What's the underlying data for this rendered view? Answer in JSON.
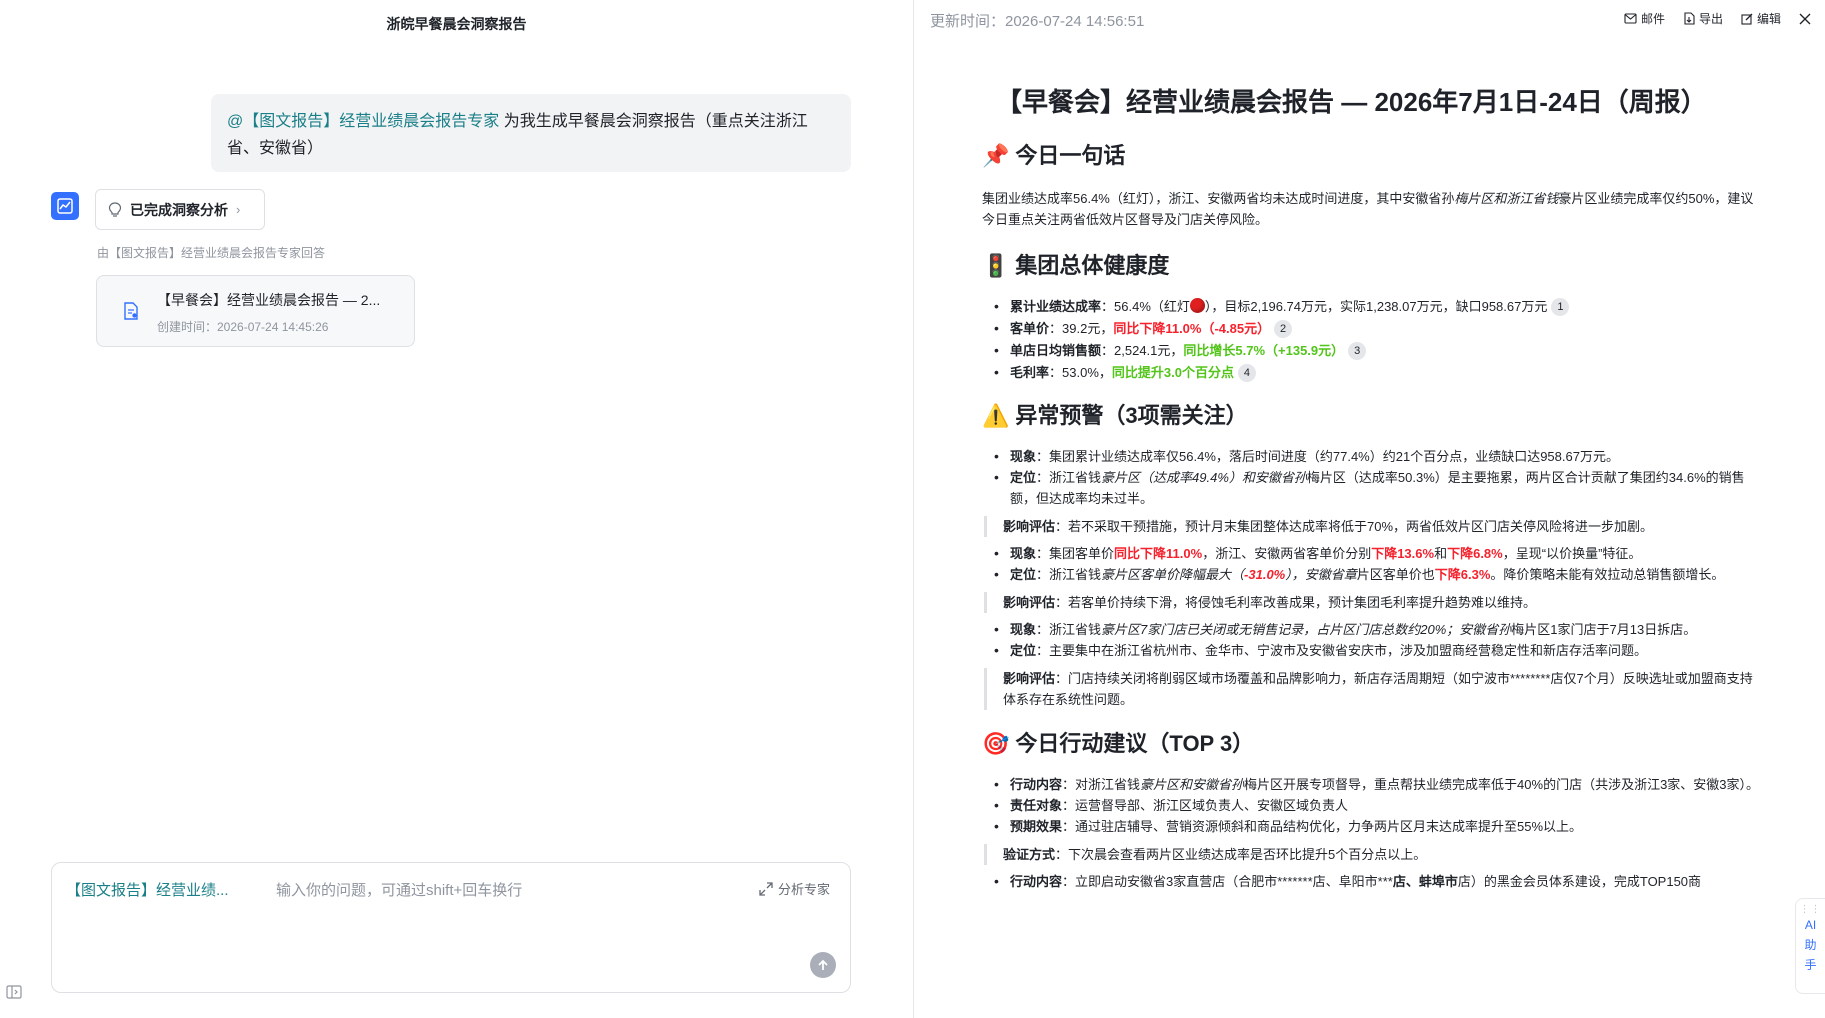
{
  "left": {
    "title": "浙皖早餐晨会洞察报告",
    "user_message": {
      "mention": "@【图文报告】经营业绩晨会报告专家",
      "text": " 为我生成早餐晨会洞察报告（重点关注浙江省、安徽省）"
    },
    "analysis_pill": "已完成洞察分析",
    "reply_meta": "由【图文报告】经营业绩晨会报告专家回答",
    "doc_card": {
      "title": "【早餐会】经营业绩晨会报告 — 2...",
      "time": "创建时间：2026-07-24 14:45:26"
    },
    "input": {
      "chip": "【图文报告】经营业绩...",
      "placeholder": "输入你的问题，可通过shift+回车换行",
      "expert_label": "分析专家"
    }
  },
  "right": {
    "update_time": "更新时间：2026-07-24 14:56:51",
    "actions": {
      "mail": "邮件",
      "export": "导出",
      "edit": "编辑"
    },
    "ai_helper": [
      "AI",
      "助",
      "手"
    ],
    "report": {
      "title": "【早餐会】经营业绩晨会报告 — 2026年7月1日-24日（周报）",
      "s1": {
        "icon": "📌",
        "heading": "今日一句话",
        "p_a": "集团业绩达成率56.4%（红灯），浙江、安徽两省均未达成时间进度，其中安徽省孙",
        "p_em": "梅片区和浙江省钱",
        "p_b": "豪片区业绩完成率仅约50%，建议今日重点关注两省低效片区督导及门店关停风险。"
      },
      "s2": {
        "icon": "🚦",
        "heading": "集团总体健康度",
        "i1_label": "累计业绩达成率",
        "i1_a": "：56.4%（红灯",
        "i1_b": "），目标2,196.74万元，实际1,238.07万元，缺口958.67万元",
        "i1_cite": "1",
        "i2_label": "客单价",
        "i2_a": "：39.2元，",
        "i2_red": "同比下降11.0%（-4.85元）",
        "i2_cite": "2",
        "i3_label": "单店日均销售额",
        "i3_a": "：2,524.1元，",
        "i3_green": "同比增长5.7%（+135.9元）",
        "i3_cite": "3",
        "i4_label": "毛利率",
        "i4_a": "：53.0%，",
        "i4_green": "同比提升3.0个百分点",
        "i4_cite": "4"
      },
      "s3": {
        "icon": "⚠️",
        "heading": "异常预警（3项需关注）",
        "a1_l1": "现象",
        "a1_t1": "：集团累计业绩达成率仅56.4%，落后时间进度（约77.4%）约21个百分点，业绩缺口达958.67万元。",
        "a1_l2": "定位",
        "a1_t2a": "：浙江省钱",
        "a1_t2em": "豪片区（达成率49.4%）和安徽省孙",
        "a1_t2b": "梅片区（达成率50.3%）是主要拖累，两片区合计贡献了集团约34.6%的销售额，但达成率均未过半。",
        "a1_ql": "影响评估",
        "a1_q": "：若不采取干预措施，预计月末集团整体达成率将低于70%，两省低效片区门店关停风险将进一步加剧。",
        "a2_l1": "现象",
        "a2_t1a": "：集团客单价",
        "a2_t1red": "同比下降11.0%",
        "a2_t1b": "，浙江、安徽两省客单价分别",
        "a2_t1red2": "下降13.6%",
        "a2_t1c": "和",
        "a2_t1red3": "下降6.8%",
        "a2_t1d": "，呈现“以价换量”特征。",
        "a2_l2": "定位",
        "a2_t2a": "：浙江省钱",
        "a2_t2em": "豪片区客单价降幅最大（",
        "a2_t2red": "-31.0%",
        "a2_t2em2": "），安徽省章",
        "a2_t2b": "片区客单价也",
        "a2_t2red2": "下降6.3%",
        "a2_t2c": "。降价策略未能有效拉动总销售额增长。",
        "a2_ql": "影响评估",
        "a2_q": "：若客单价持续下滑，将侵蚀毛利率改善成果，预计集团毛利率提升趋势难以维持。",
        "a3_l1": "现象",
        "a3_t1a": "：浙江省钱",
        "a3_t1em": "豪片区7家门店已关闭或无销售记录，占片区门店总数约20%；安徽省孙",
        "a3_t1b": "梅片区1家门店于7月13日拆店。",
        "a3_l2": "定位",
        "a3_t2": "：主要集中在浙江省杭州市、金华市、宁波市及安徽省安庆市，涉及加盟商经营稳定性和新店存活率问题。",
        "a3_ql": "影响评估",
        "a3_q": "：门店持续关闭将削弱区域市场覆盖和品牌影响力，新店存活周期短（如宁波市********店仅7个月）反映选址或加盟商支持体系存在系统性问题。"
      },
      "s4": {
        "icon": "🎯",
        "heading": "今日行动建议（TOP 3）",
        "b1_l1": "行动内容",
        "b1_t1a": "：对浙江省钱",
        "b1_t1em": "豪片区和安徽省孙",
        "b1_t1b": "梅片区开展专项督导，重点帮扶业绩完成率低于40%的门店（共涉及浙江3家、安徽3家）。",
        "b1_l2": "责任对象",
        "b1_t2": "：运营督导部、浙江区域负责人、安徽区域负责人",
        "b1_l3": "预期效果",
        "b1_t3": "：通过驻店辅导、营销资源倾斜和商品结构优化，力争两片区月末达成率提升至55%以上。",
        "b1_ql": "验证方式",
        "b1_q": "：下次晨会查看两片区业绩达成率是否环比提升5个百分点以上。",
        "b2_l1": "行动内容",
        "b2_t1a": "：立即启动安徽省3家直营店（合肥市*******店、阜阳市***",
        "b2_t1b": "店、蚌埠市",
        "b2_t1c": "店）的黑金会员体系建设，完成TOP150商"
      }
    }
  }
}
